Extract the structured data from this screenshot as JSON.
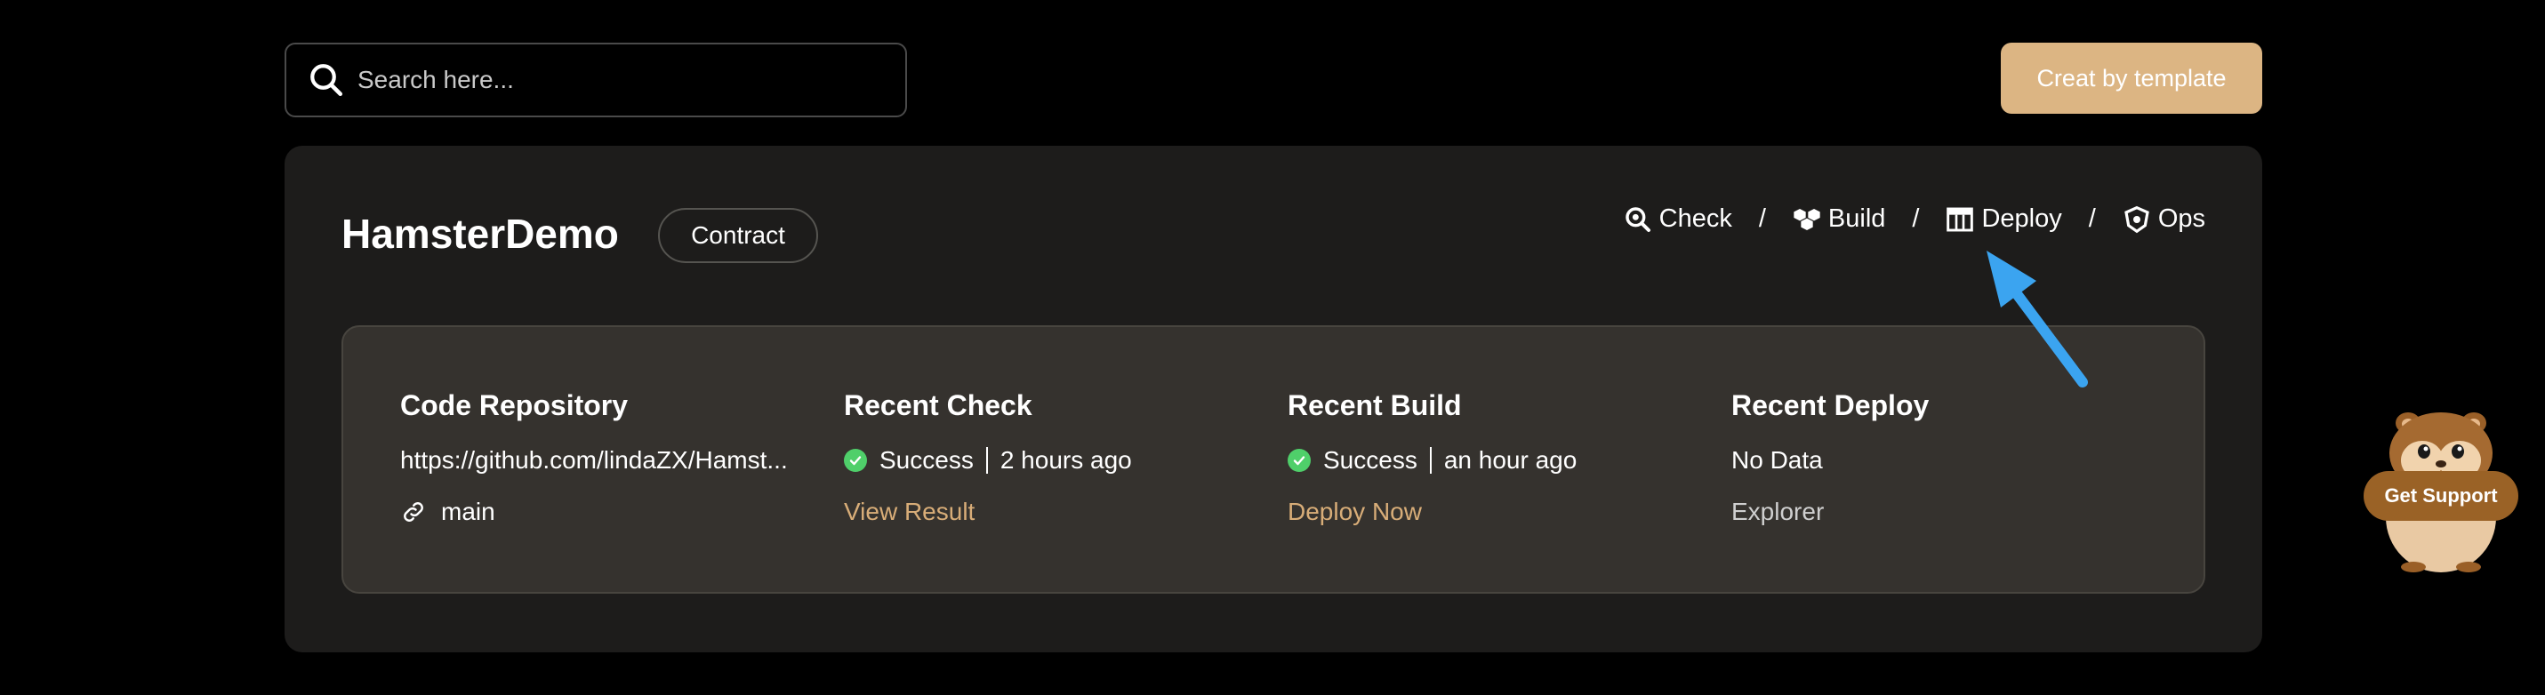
{
  "search": {
    "placeholder": "Search here..."
  },
  "header": {
    "create_button_label": "Creat by template"
  },
  "project": {
    "name": "HamsterDemo",
    "type_tag": "Contract",
    "steps": [
      {
        "label": "Check",
        "icon": "check-search-icon"
      },
      {
        "label": "Build",
        "icon": "build-cubes-icon"
      },
      {
        "label": "Deploy",
        "icon": "deploy-table-icon"
      },
      {
        "label": "Ops",
        "icon": "ops-shield-icon"
      }
    ],
    "step_separator": "/"
  },
  "panel": {
    "code_repository": {
      "title": "Code Repository",
      "url": "https://github.com/lindaZX/Hamst...",
      "branch": "main"
    },
    "recent_check": {
      "title": "Recent Check",
      "status": "Success",
      "time": "2 hours ago",
      "action": "View Result"
    },
    "recent_build": {
      "title": "Recent Build",
      "status": "Success",
      "time": "an hour ago",
      "action": "Deploy Now"
    },
    "recent_deploy": {
      "title": "Recent Deploy",
      "status": "No Data",
      "action": "Explorer"
    }
  },
  "support": {
    "label": "Get Support"
  },
  "colors": {
    "background": "#000000",
    "card": "#1d1c1b",
    "panel": "#35322e",
    "accent_gold": "#dcb583",
    "link_gold": "#d8ad78",
    "success_green": "#4fcf6a",
    "arrow_blue": "#3ba4f0"
  }
}
